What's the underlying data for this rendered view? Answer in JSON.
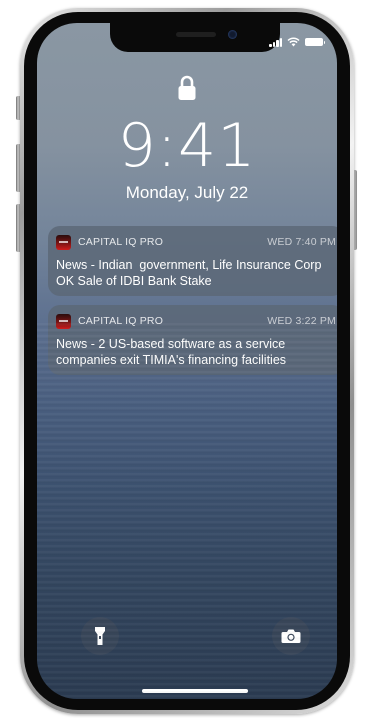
{
  "status_bar": {
    "signal_bars": 4,
    "wifi_icon": "wifi-icon",
    "battery_icon": "battery-icon"
  },
  "lock_screen": {
    "lock_icon": "lock-icon",
    "time": "9:41",
    "date": "Monday, July 22"
  },
  "notifications": [
    {
      "app_name": "CAPITAL IQ PRO",
      "time": "WED 7:40 PM",
      "body": "News - Indian  government, Life Insurance Corp OK Sale of IDBI Bank Stake"
    },
    {
      "app_name": "CAPITAL IQ PRO",
      "time": "WED 3:22 PM",
      "body": "News - 2 US-based software as a service companies exit TIMIA's financing facilities"
    }
  ],
  "quick_actions": {
    "flashlight_icon": "flashlight-icon",
    "camera_icon": "camera-icon"
  },
  "colors": {
    "app_icon_accent": "#d01c1c",
    "notification_bg": "#5c6876",
    "text": "#ffffff"
  }
}
